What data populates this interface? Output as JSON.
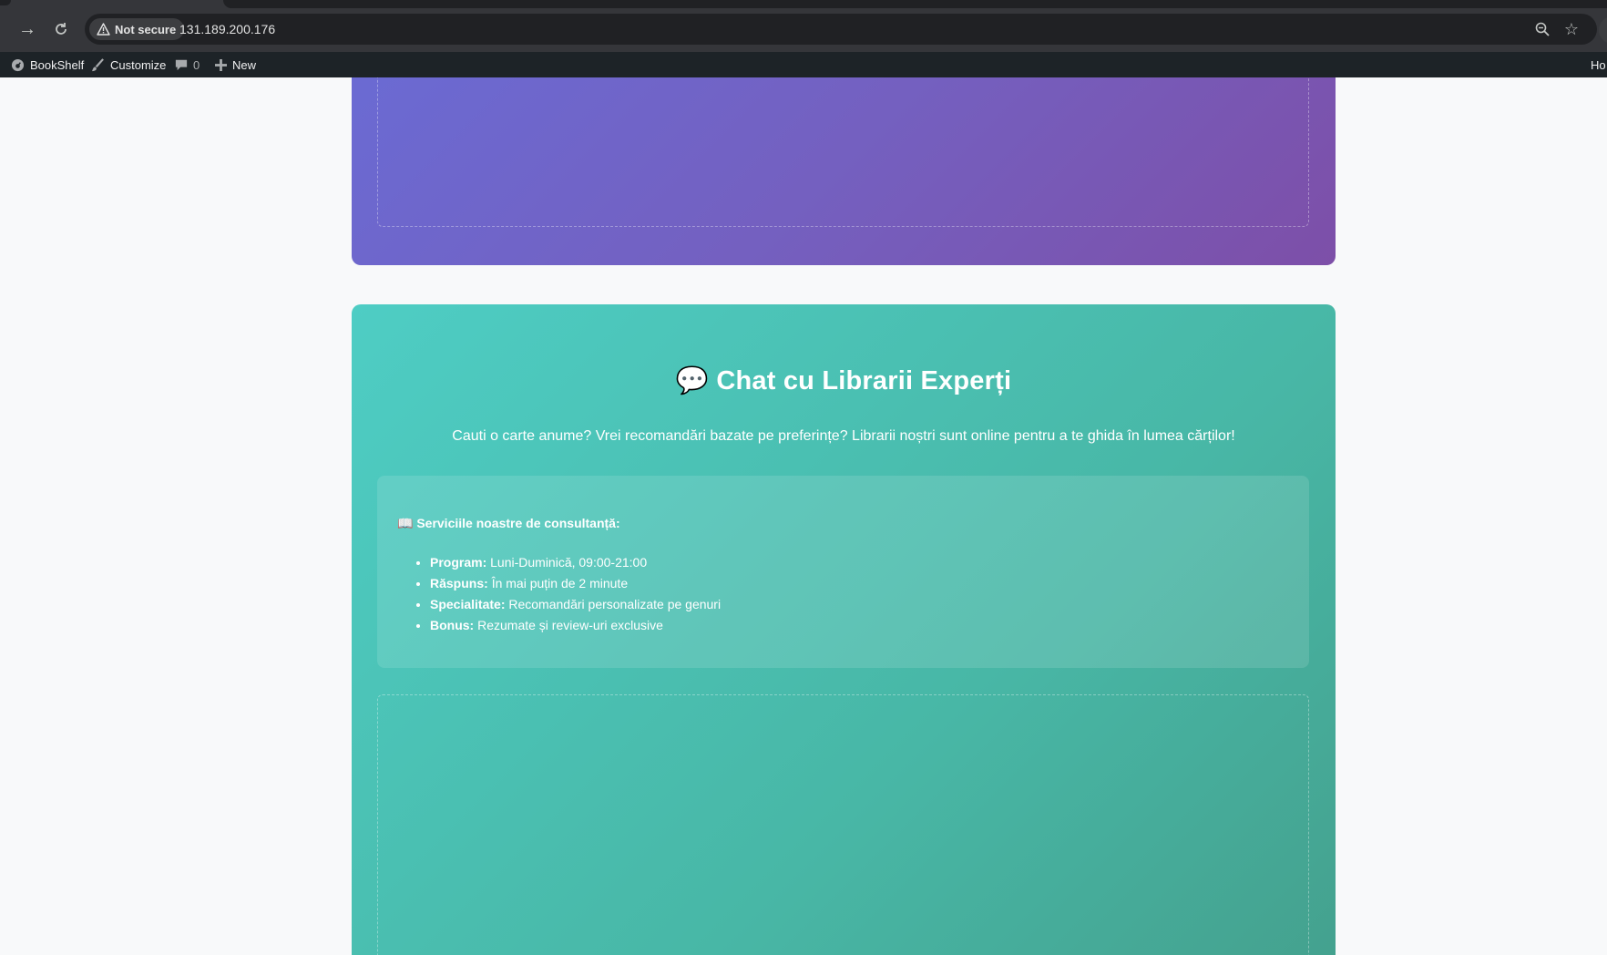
{
  "browser": {
    "security_label": "Not secure",
    "url": "131.189.200.176"
  },
  "admin_bar": {
    "site_name": "BookShelf",
    "customize": "Customize",
    "comments_count": "0",
    "new_label": "New",
    "howdy_partial": "Ho"
  },
  "chat_section": {
    "emoji": "💬",
    "title": "Chat cu Librarii Experți",
    "subtitle": "Cauti o carte anume? Vrei recomandări bazate pe preferințe? Librarii noștri sunt online pentru a te ghida în lumea cărților!",
    "services_heading": "Serviciile noastre de consultanță:",
    "services": [
      {
        "label": "Program:",
        "value": "Luni-Duminică, 09:00-21:00"
      },
      {
        "label": "Răspuns:",
        "value": "În mai puțin de 2 minute"
      },
      {
        "label": "Specialitate:",
        "value": "Recomandări personalizate pe genuri"
      },
      {
        "label": "Bonus:",
        "value": "Rezumate și review-uri exclusive"
      }
    ]
  },
  "colors": {
    "teal_start": "#4ecdc4",
    "teal_end": "#44a08d",
    "purple_start": "#6a6bd4",
    "purple_end": "#7d4fa8",
    "admin_bar": "#1d2327"
  }
}
